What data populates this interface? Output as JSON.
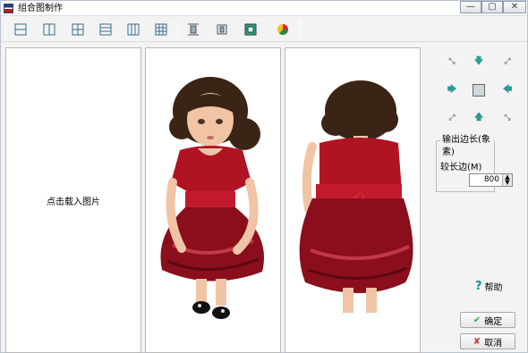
{
  "window": {
    "title": "组合图制作",
    "controls": [
      "—",
      "▢",
      "✕"
    ]
  },
  "toolbar": {
    "buttons": [
      {
        "icon": "layout-2-rows-icon"
      },
      {
        "icon": "layout-2-cols-icon"
      },
      {
        "icon": "layout-grid-2x2-icon"
      },
      {
        "icon": "layout-3-rows-icon"
      },
      {
        "icon": "layout-3-cols-icon"
      },
      {
        "icon": "layout-grid-3x3-icon"
      },
      {
        "icon": "fit-width-icon"
      },
      {
        "icon": "fit-height-icon"
      },
      {
        "icon": "fit-frame-icon"
      },
      {
        "icon": "color-wheel-icon"
      }
    ]
  },
  "canvas": {
    "empty_cell_hint": "点击载入图片",
    "cells": [
      {
        "content": "empty"
      },
      {
        "content": "doll-front-photo"
      },
      {
        "content": "doll-back-photo"
      }
    ]
  },
  "nav_pad": {
    "arrows": [
      "corner-up-left-icon",
      "arrow-down-icon",
      "corner-up-right-icon",
      "arrow-right-icon",
      "image-center-icon",
      "arrow-left-icon",
      "corner-down-left-icon",
      "arrow-up-icon",
      "corner-down-right-icon"
    ]
  },
  "output": {
    "group_title": "输出边长(象素)",
    "long_side_label": "较长边(M)",
    "long_side_value": "800"
  },
  "help": {
    "label": "帮助"
  },
  "ok_button": {
    "label": "确定"
  },
  "cancel_button": {
    "label": "取消"
  },
  "colors": {
    "accent": "#2e9a9a",
    "doll_dress": "#b01423",
    "hair": "#3a2416"
  }
}
